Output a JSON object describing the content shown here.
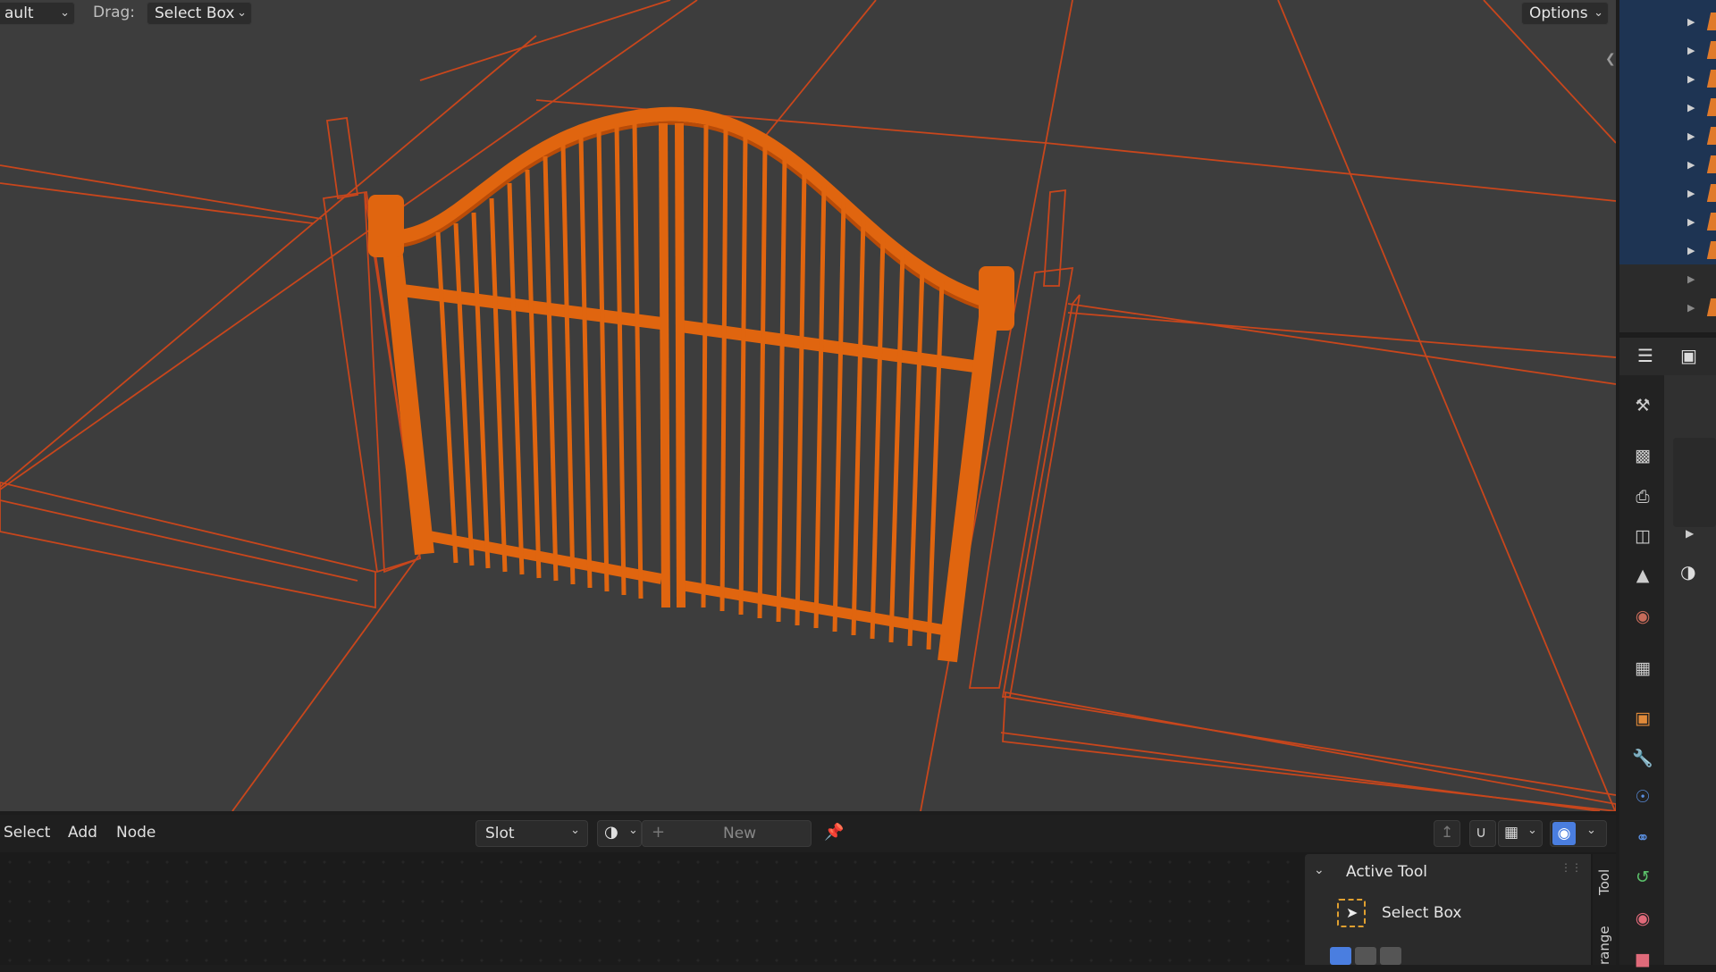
{
  "viewport_header": {
    "mode_dropdown": "ault",
    "drag_label": "Drag:",
    "drag_value": "Select Box",
    "options_label": "Options"
  },
  "node_editor": {
    "menus": [
      "Select",
      "Add",
      "Node"
    ],
    "slot_label": "Slot",
    "new_label": "New"
  },
  "tool_panel": {
    "header": "Active Tool",
    "tool_name": "Select Box"
  },
  "side_tabs": {
    "tool": "Tool",
    "arrange": "range"
  },
  "colors": {
    "selection_orange": "#e0650f",
    "wire_orange": "#e0541f",
    "viewport_bg": "#3d3d3d",
    "outliner_selected": "#1e3453",
    "accent_blue": "#4a7ee0"
  },
  "icons": {
    "pin": "pin-icon",
    "material": "material-sphere-icon",
    "overlay": "overlay-icon"
  }
}
